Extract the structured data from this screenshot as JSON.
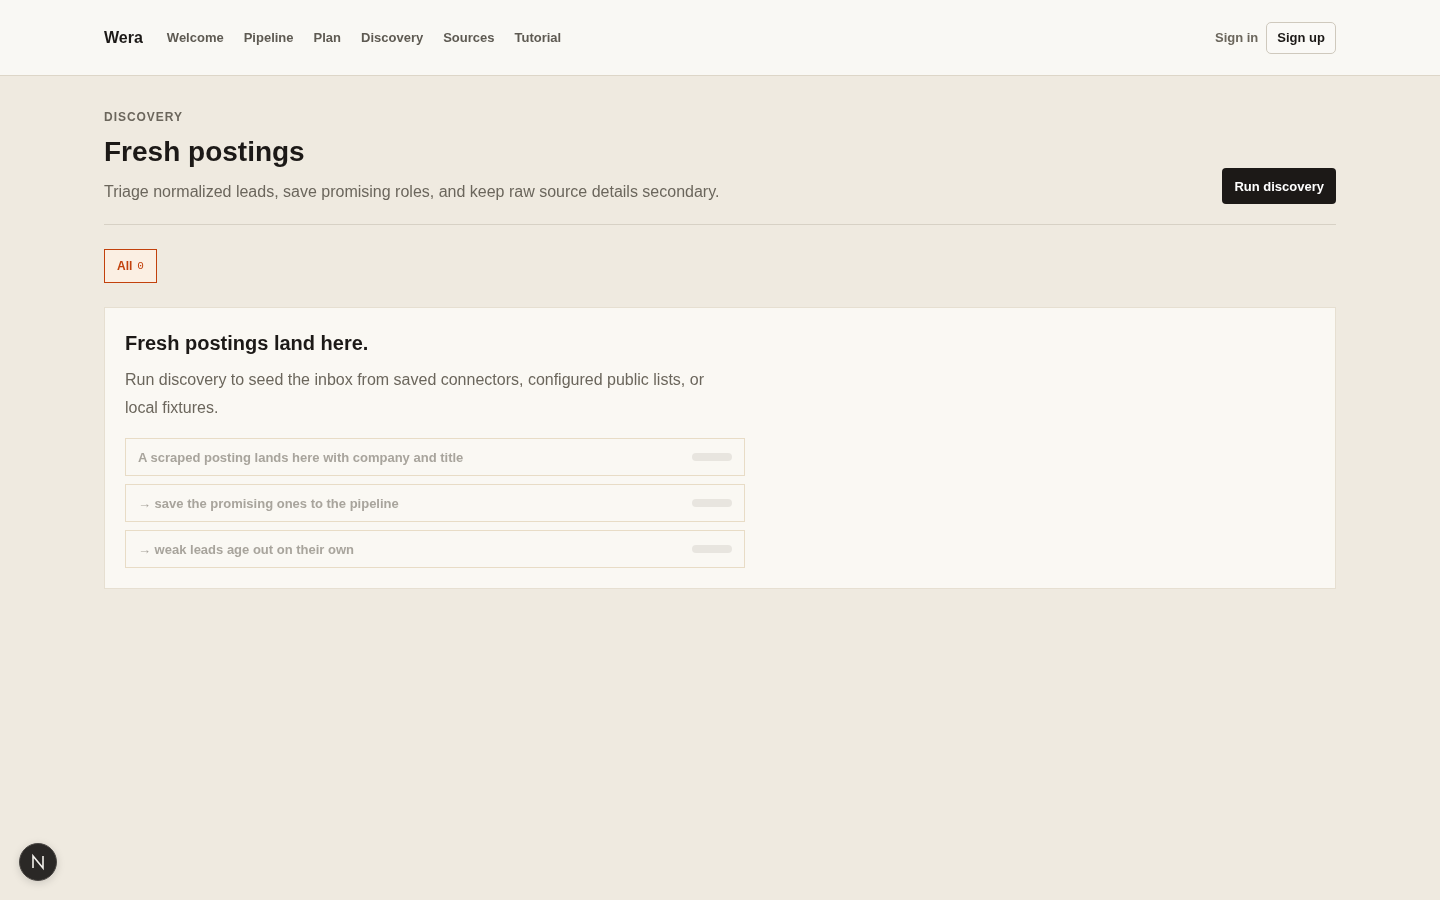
{
  "nav": {
    "brand": "Wera",
    "links": [
      "Welcome",
      "Pipeline",
      "Plan",
      "Discovery",
      "Sources",
      "Tutorial"
    ],
    "sign_in": "Sign in",
    "sign_up": "Sign up"
  },
  "page": {
    "eyebrow": "DISCOVERY",
    "title": "Fresh postings",
    "subtitle": "Triage normalized leads, save promising roles, and keep raw source details secondary.",
    "action": "Run discovery"
  },
  "filters": [
    {
      "label": "All",
      "count": "0",
      "selected": true
    }
  ],
  "empty_state": {
    "title": "Fresh postings land here.",
    "text": "Run discovery to seed the inbox from saved connectors, configured public lists, or local fixtures.",
    "examples": [
      "A scraped posting lands here with company and title",
      "→ save the promising ones to the pipeline",
      "→ weak leads age out on their own"
    ]
  }
}
